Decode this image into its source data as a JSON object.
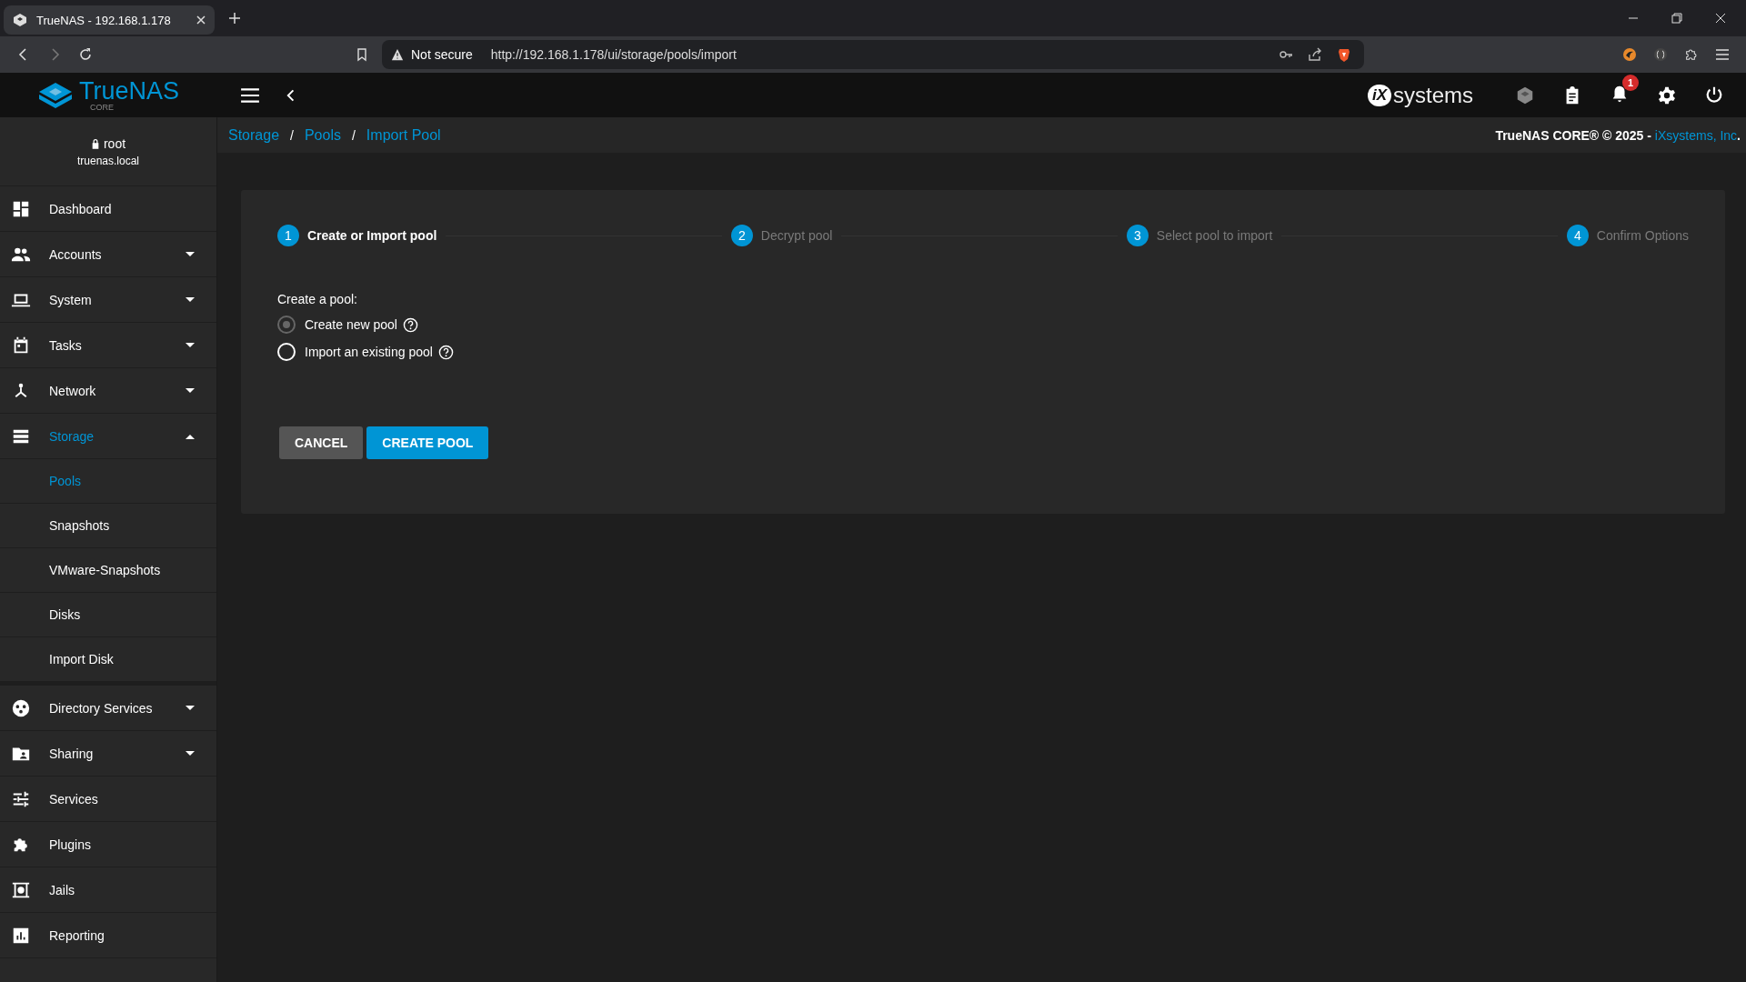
{
  "browser": {
    "tab_title": "TrueNAS - 192.168.1.178",
    "security": "Not secure",
    "url": "http://192.168.1.178/ui/storage/pools/import"
  },
  "topbar": {
    "logo": "TrueNAS",
    "logo_sub": "CORE",
    "vendor_mark": "iX",
    "vendor_name": "systems",
    "notifications": "1"
  },
  "breadcrumb": {
    "separator": "/",
    "items": [
      "Storage",
      "Pools",
      "Import Pool"
    ]
  },
  "copyright": {
    "text": "TrueNAS CORE® © 2025 - ",
    "link": "iXsystems, Inc",
    "end": "."
  },
  "user": {
    "name": "root",
    "host": "truenas.local"
  },
  "sidebar": [
    {
      "label": "Dashboard",
      "selected": false
    },
    {
      "label": "Accounts",
      "selected": false,
      "expanded": false
    },
    {
      "label": "System",
      "selected": false,
      "expanded": false
    },
    {
      "label": "Tasks",
      "selected": false,
      "expanded": false
    },
    {
      "label": "Network",
      "selected": false,
      "expanded": false
    },
    {
      "label": "Storage",
      "selected": true,
      "expanded": true,
      "children": [
        {
          "label": "Pools",
          "selected": true
        },
        {
          "label": "Snapshots",
          "selected": false
        },
        {
          "label": "VMware-Snapshots",
          "selected": false
        },
        {
          "label": "Disks",
          "selected": false
        },
        {
          "label": "Import Disk",
          "selected": false
        }
      ]
    },
    {
      "label": "Directory Services",
      "selected": false,
      "expanded": false
    },
    {
      "label": "Sharing",
      "selected": false,
      "expanded": false
    },
    {
      "label": "Services",
      "selected": false
    },
    {
      "label": "Plugins",
      "selected": false
    },
    {
      "label": "Jails",
      "selected": false
    },
    {
      "label": "Reporting",
      "selected": false
    }
  ],
  "steps": [
    {
      "number": "1",
      "label": "Create or Import pool",
      "selected": true
    },
    {
      "number": "2",
      "label": "Decrypt pool",
      "selected": false
    },
    {
      "number": "3",
      "label": "Select pool to import",
      "selected": false
    },
    {
      "number": "4",
      "label": "Confirm Options",
      "selected": false
    }
  ],
  "form": {
    "label": "Create a pool:",
    "options": [
      {
        "label": "Create new pool",
        "selected": true
      },
      {
        "label": "Import an existing pool",
        "selected": false
      }
    ]
  },
  "buttons": [
    {
      "label": "CANCEL",
      "kind": "secondary"
    },
    {
      "label": "CREATE POOL",
      "kind": "primary"
    }
  ]
}
